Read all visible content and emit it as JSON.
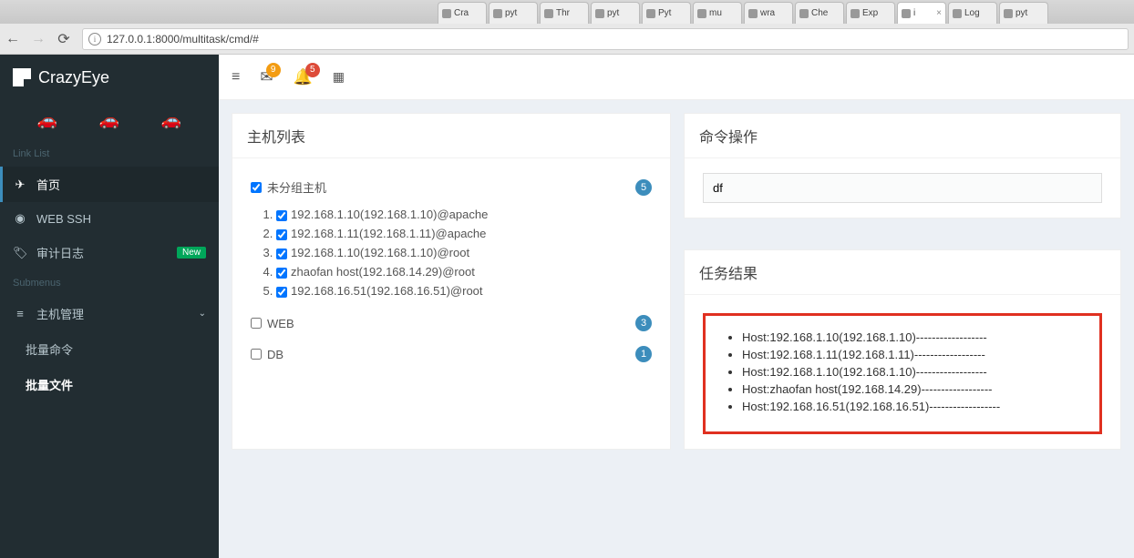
{
  "browser": {
    "url": "127.0.0.1:8000/multitask/cmd/#",
    "tabs": [
      "Cra",
      "pyt",
      "Thr",
      "pyt",
      "Pyt",
      "mu",
      "wra",
      "Che",
      "Exp",
      "i",
      "Log",
      "pyt"
    ],
    "active_tab_index": 9
  },
  "brand": "CrazyEye",
  "sidebar": {
    "link_list_label": "Link List",
    "items": [
      {
        "icon": "✈",
        "label": "首页"
      },
      {
        "icon": "☁",
        "label": "WEB SSH"
      },
      {
        "icon": "🏷",
        "label": "审计日志",
        "badge": "New"
      }
    ],
    "submenus_label": "Submenus",
    "host_mgmt": {
      "icon": "☰",
      "label": "主机管理"
    },
    "sub_items": [
      {
        "label": "批量命令"
      },
      {
        "label": "批量文件"
      }
    ]
  },
  "topbar": {
    "badge_mail": "9",
    "badge_bell": "5"
  },
  "host_panel": {
    "title": "主机列表",
    "groups": [
      {
        "name": "未分组主机",
        "count": "5",
        "checked": true,
        "hosts": [
          "192.168.1.10(192.168.1.10)@apache",
          "192.168.1.11(192.168.1.11)@apache",
          "192.168.1.10(192.168.1.10)@root",
          "zhaofan host(192.168.14.29)@root",
          "192.168.16.51(192.168.16.51)@root"
        ]
      },
      {
        "name": "WEB",
        "count": "3",
        "checked": false
      },
      {
        "name": "DB",
        "count": "1",
        "checked": false
      }
    ]
  },
  "cmd_panel": {
    "title": "命令操作",
    "value": "df"
  },
  "result_panel": {
    "title": "任务结果",
    "results": [
      "Host:192.168.1.10(192.168.1.10)------------------",
      "Host:192.168.1.11(192.168.1.11)------------------",
      "Host:192.168.1.10(192.168.1.10)------------------",
      "Host:zhaofan host(192.168.14.29)------------------",
      "Host:192.168.16.51(192.168.16.51)------------------"
    ]
  }
}
